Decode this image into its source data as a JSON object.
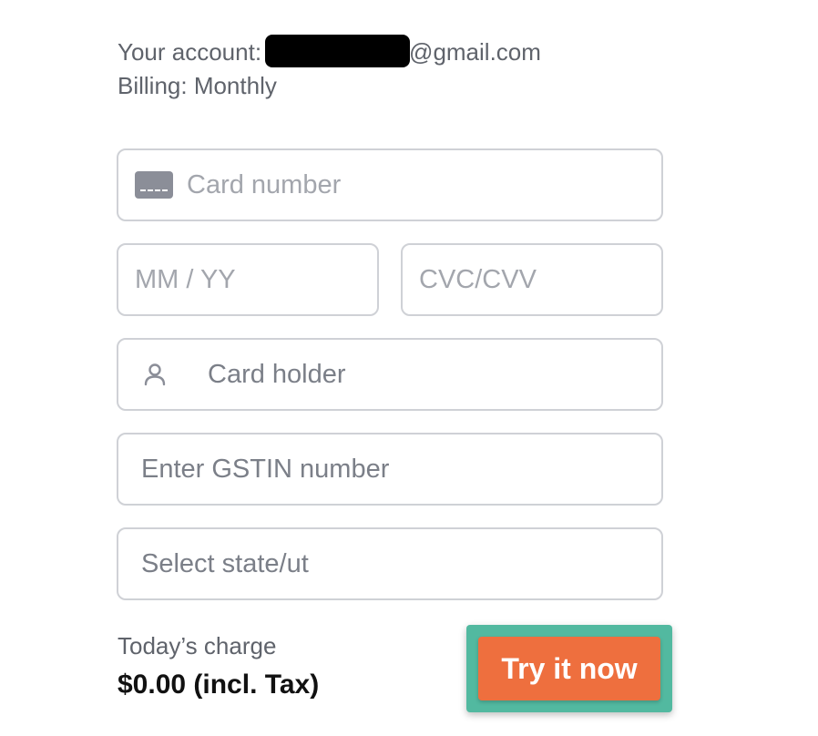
{
  "account": {
    "label": "Your account:",
    "email_suffix": "@gmail.com",
    "billing": "Billing: Monthly"
  },
  "form": {
    "card_number": {
      "placeholder": "Card number",
      "value": ""
    },
    "expiry": {
      "placeholder": "MM / YY",
      "value": ""
    },
    "cvc": {
      "placeholder": "CVC/CVV",
      "value": ""
    },
    "card_holder": {
      "placeholder": "Card holder",
      "value": ""
    },
    "gstin": {
      "placeholder": "Enter GSTIN number",
      "value": ""
    },
    "state": {
      "placeholder": "Select state/ut",
      "value": ""
    }
  },
  "summary": {
    "charge_label": "Today’s charge",
    "charge_amount": "$0.00 (incl. Tax)"
  },
  "cta": {
    "label": "Try it now",
    "highlight_color": "#52b9a0",
    "button_color": "#ee6f3e"
  },
  "icons": {
    "card": "credit-card-icon",
    "holder": "user-icon"
  }
}
